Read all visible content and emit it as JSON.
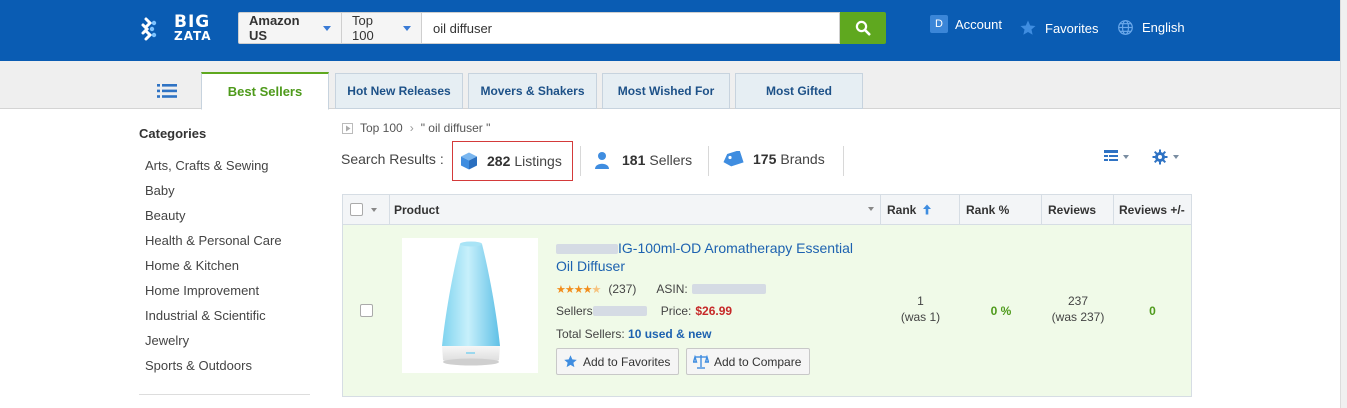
{
  "header": {
    "logo_line1": "BIG",
    "logo_line2": "ZATA",
    "market_select": "Amazon US",
    "list_select": "Top 100",
    "search_value": "oil diffuser",
    "account_badge": "D",
    "account_label": "Account",
    "favorites_label": "Favorites",
    "language_label": "English"
  },
  "tabs": [
    {
      "label": "Best Sellers",
      "active": true
    },
    {
      "label": "Hot New Releases"
    },
    {
      "label": "Movers & Shakers"
    },
    {
      "label": "Most Wished For"
    },
    {
      "label": "Most Gifted"
    }
  ],
  "sidebar": {
    "title": "Categories",
    "items": [
      "Arts, Crafts & Sewing",
      "Baby",
      "Beauty",
      "Health & Personal Care",
      "Home & Kitchen",
      "Home Improvement",
      "Industrial & Scientific",
      "Jewelry",
      "Sports & Outdoors"
    ]
  },
  "breadcrumb": {
    "root": "Top 100",
    "query": "\" oil diffuser \""
  },
  "summary": {
    "label": "Search Results :",
    "listings_count": "282",
    "listings_label": "Listings",
    "sellers_count": "181",
    "sellers_label": "Sellers",
    "brands_count": "175",
    "brands_label": "Brands"
  },
  "table": {
    "headers": {
      "product": "Product",
      "rank": "Rank",
      "rank_pct": "Rank %",
      "reviews": "Reviews",
      "reviews_delta": "Reviews +/-"
    },
    "rows": [
      {
        "title": "IG-100ml-OD Aromatherapy Essential Oil Diffuser",
        "rating": 4.5,
        "review_count": "(237)",
        "asin_label": "ASIN:",
        "sellers_label": "Sellers",
        "price_label": "Price:",
        "price": "$26.99",
        "total_sellers_label": "Total Sellers:",
        "total_sellers_value": "10 used & new",
        "add_fav_label": "Add to Favorites",
        "add_compare_label": "Add to Compare",
        "rank": "1",
        "rank_was": "(was 1)",
        "rank_pct": "0 %",
        "reviews": "237",
        "reviews_was": "(was 237)",
        "reviews_delta": "0"
      }
    ]
  },
  "colors": {
    "header_bg": "#0a5cb3",
    "search_button": "#5fa81f",
    "active_tab_accent": "#5fa81f",
    "link": "#1d62b0",
    "price": "#c62828",
    "positive": "#4e9a1b",
    "row_highlight": "#f0fae8",
    "listings_outline": "#d43a3a"
  },
  "icons": {
    "logo": "bigzata-logo-icon",
    "search": "search-icon",
    "favorites": "star-icon",
    "language": "globe-icon",
    "menu": "list-menu-icon",
    "listings": "box-icon",
    "sellers": "person-icon",
    "brands": "tag-icon",
    "view": "table-view-icon",
    "settings": "gear-icon",
    "sort": "arrow-up-icon",
    "compare": "scale-icon"
  }
}
